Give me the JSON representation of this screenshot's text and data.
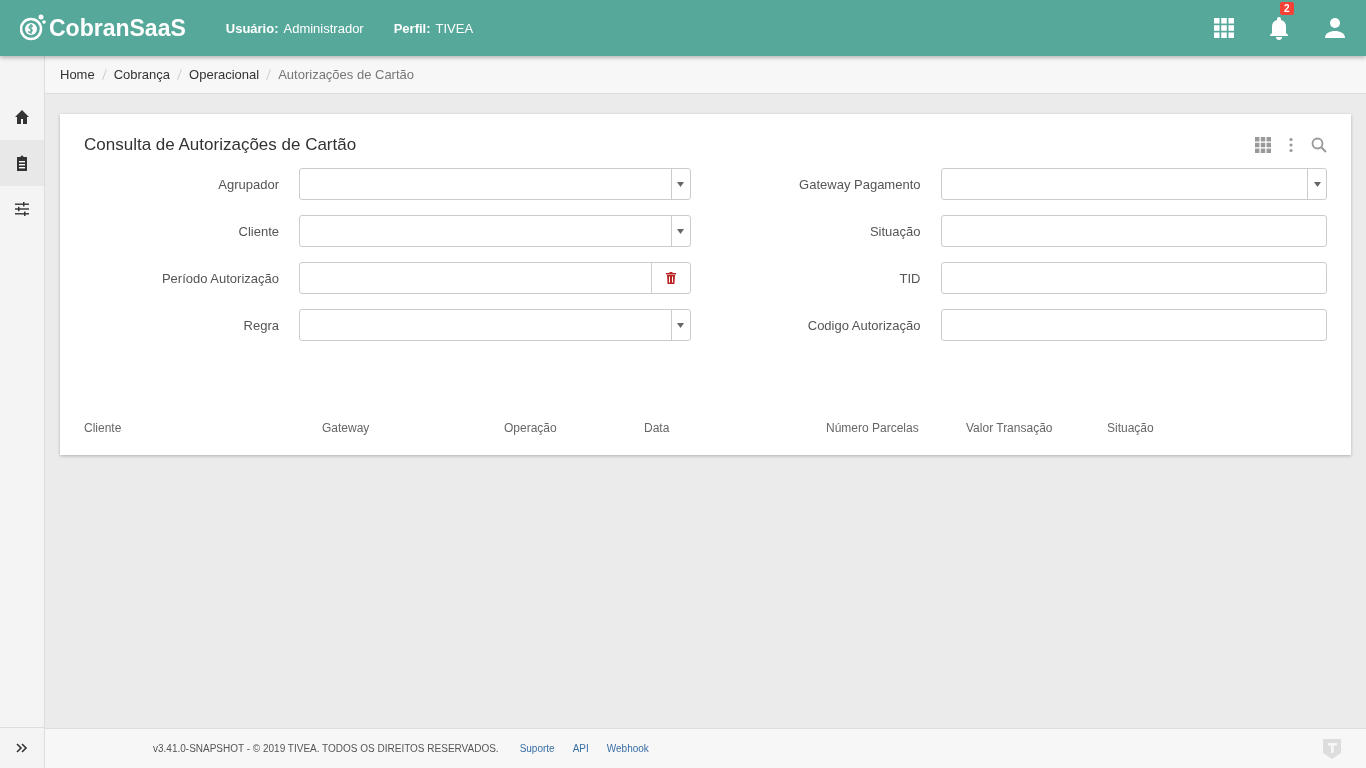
{
  "header": {
    "brand": "CobranSaaS",
    "user_label": "Usuário:",
    "user_value": "Administrador",
    "profile_label": "Perfil:",
    "profile_value": "TIVEA",
    "notification_count": "2"
  },
  "sidebar": {
    "items": [
      {
        "selected": false
      },
      {
        "selected": true
      },
      {
        "selected": false
      }
    ]
  },
  "breadcrumb": [
    "Home",
    "Cobrança",
    "Operacional",
    "Autorizações de Cartão"
  ],
  "panel": {
    "title": "Consulta de Autorizações de Cartão",
    "filters_left": [
      {
        "label": "Agrupador",
        "kind": "select"
      },
      {
        "label": "Cliente",
        "kind": "select"
      },
      {
        "label": "Período Autorização",
        "kind": "daterange"
      },
      {
        "label": "Regra",
        "kind": "select"
      }
    ],
    "filters_right": [
      {
        "label": "Gateway Pagamento",
        "kind": "select"
      },
      {
        "label": "Situação",
        "kind": "text"
      },
      {
        "label": "TID",
        "kind": "text"
      },
      {
        "label": "Codigo Autorização",
        "kind": "text"
      }
    ],
    "columns": [
      "Cliente",
      "Gateway",
      "Operação",
      "Data",
      "Número Parcelas",
      "Valor Transação",
      "Situação"
    ]
  },
  "footer": {
    "copyright": "v3.41.0-SNAPSHOT - © 2019 TIVEA. TODOS OS DIREITOS RESERVADOS.",
    "links": [
      "Suporte",
      "API",
      "Webhook"
    ]
  }
}
